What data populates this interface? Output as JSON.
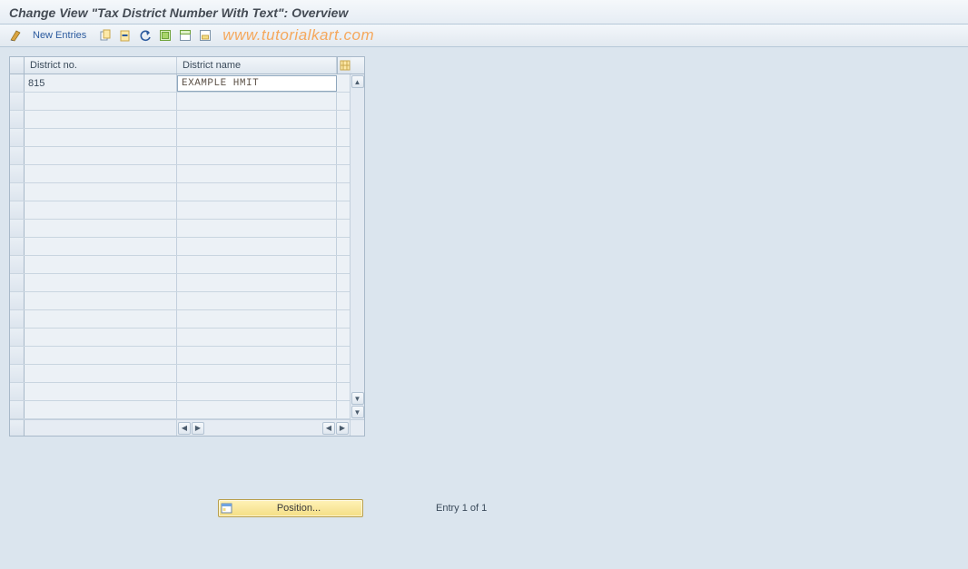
{
  "title": "Change View \"Tax District Number With Text\": Overview",
  "toolbar": {
    "new_entries_label": "New Entries"
  },
  "watermark": "www.tutorialkart.com",
  "grid": {
    "columns": {
      "district_no": "District no.",
      "district_name": "District name"
    },
    "rows": [
      {
        "no": "815",
        "name": "EXAMPLE HMIT"
      }
    ],
    "empty_row_count": 18
  },
  "footer": {
    "position_btn": "Position...",
    "entry_text": "Entry 1 of 1"
  }
}
